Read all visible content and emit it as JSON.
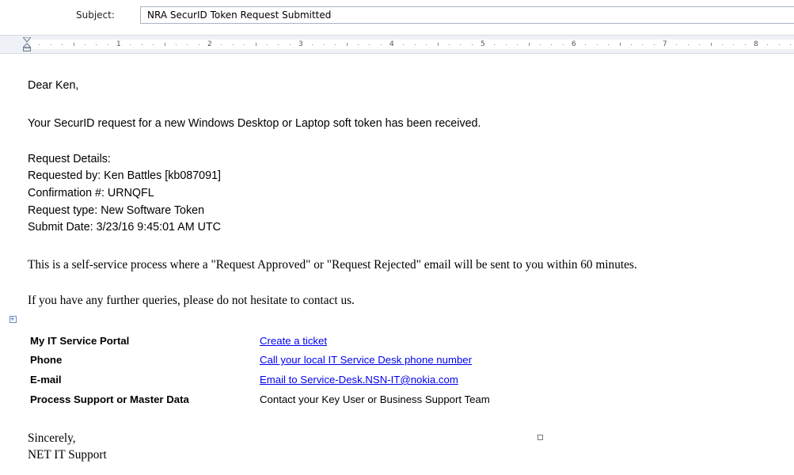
{
  "subject": {
    "label": "Subject:",
    "value": "NRA SecurID Token Request Submitted"
  },
  "ruler": {
    "numbers": [
      "1",
      "2",
      "3",
      "4",
      "5",
      "6",
      "7",
      "8"
    ]
  },
  "email": {
    "greeting": "Dear Ken,",
    "intro": "Your SecurID request for a new Windows Desktop or Laptop soft token has been received.",
    "details_heading": "Request Details:",
    "requested_by": "Requested by: Ken Battles [kb087091]",
    "confirmation": "Confirmation #: URNQFL",
    "request_type": "Request type: New Software Token",
    "submit_date": "Submit Date: 3/23/16 9:45:01 AM UTC",
    "process_note": "This is a self-service process where a \"Request Approved\" or \"Request Rejected\" email will be sent to you within 60 minutes.",
    "queries_note": "If you have any further queries, please do not hesitate to contact us.",
    "contacts": [
      {
        "label": "My IT Service Portal",
        "value": "Create a ticket"
      },
      {
        "label": "Phone",
        "value": "Call your local IT Service Desk phone number"
      },
      {
        "label": "E-mail",
        "value": "Email to Service-Desk.NSN-IT@nokia.com"
      },
      {
        "label": "Process Support or Master Data",
        "value": "Contact your Key User or Business Support Team"
      }
    ],
    "closing": "Sincerely,",
    "signature": "NET IT Support"
  },
  "colors": {
    "link": "#0000ee",
    "ruler_background": "#eef1f5"
  },
  "icons": [
    "table-move-handle-icon",
    "indent-marker-icon",
    "resize-handle-icon"
  ]
}
